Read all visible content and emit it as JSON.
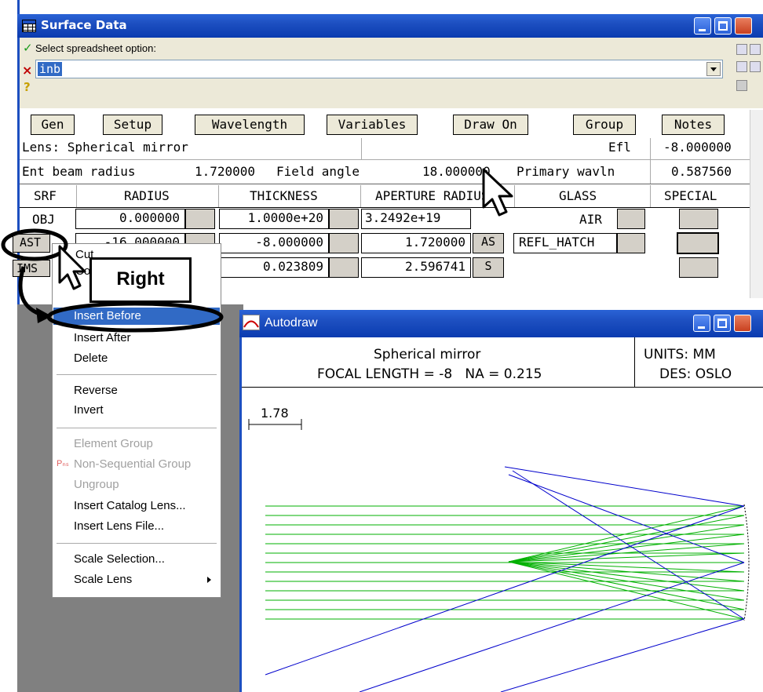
{
  "surface_window": {
    "title": "Surface Data",
    "prompt_label": "Select spreadsheet option:",
    "input_value": "inb",
    "toolbar_buttons": [
      "Gen",
      "Setup",
      "Wavelength",
      "Variables",
      "Draw On",
      "Group",
      "Notes"
    ],
    "lens_label": "Lens: Spherical mirror",
    "efl_label": "Efl",
    "efl_value": "-8.000000",
    "ent_beam_label": "Ent beam radius",
    "ent_beam_value": "1.720000",
    "field_angle_label": "Field angle",
    "field_angle_value": "18.000000",
    "primary_wavln_label": "Primary wavln",
    "primary_wavln_value": "0.587560",
    "columns": [
      "SRF",
      "RADIUS",
      "THICKNESS",
      "APERTURE RADIUS",
      "GLASS",
      "SPECIAL"
    ],
    "rows": [
      {
        "srf": "OBJ",
        "radius": "0.000000",
        "thickness": "1.0000e+20",
        "aperture": "3.2492e+19",
        "aperture_flag": "",
        "glass": "AIR"
      },
      {
        "srf": "AST",
        "radius": "-16.000000",
        "thickness": "-8.000000",
        "aperture": "1.720000",
        "aperture_flag": "AS",
        "glass": "REFL_HATCH"
      },
      {
        "srf": "IMS",
        "radius": "",
        "thickness": "0.023809",
        "aperture": "2.596741",
        "aperture_flag": "S",
        "glass": ""
      }
    ]
  },
  "context_menu": {
    "items": [
      {
        "label": "Insert Before",
        "state": "highlighted"
      },
      {
        "label": "Insert After",
        "state": "normal"
      },
      {
        "label": "Delete",
        "state": "normal"
      },
      {
        "label": "Reverse",
        "state": "normal"
      },
      {
        "label": "Invert",
        "state": "normal"
      },
      {
        "label": "Element Group",
        "state": "disabled"
      },
      {
        "label": "Non-Sequential Group",
        "state": "disabled"
      },
      {
        "label": "Ungroup",
        "state": "disabled"
      },
      {
        "label": "Insert Catalog Lens...",
        "state": "normal"
      },
      {
        "label": "Insert Lens File...",
        "state": "normal"
      },
      {
        "label": "Scale Selection...",
        "state": "normal"
      },
      {
        "label": "Scale Lens",
        "state": "normal"
      }
    ],
    "partial_items": [
      "Cut",
      "Co"
    ]
  },
  "annotation": {
    "callout_text": "Right"
  },
  "autodraw_window": {
    "title": "Autodraw",
    "heading": "Spherical mirror",
    "subheading": "FOCAL LENGTH = -8   NA = 0.215",
    "units": "UNITS: MM",
    "designer": "DES: OSLO",
    "scale_label": "1.78"
  },
  "colors": {
    "titlebar": "#1d4fc0",
    "menu_highlight": "#316ac5",
    "ray_green": "#00b000",
    "ray_blue": "#0000cc"
  }
}
